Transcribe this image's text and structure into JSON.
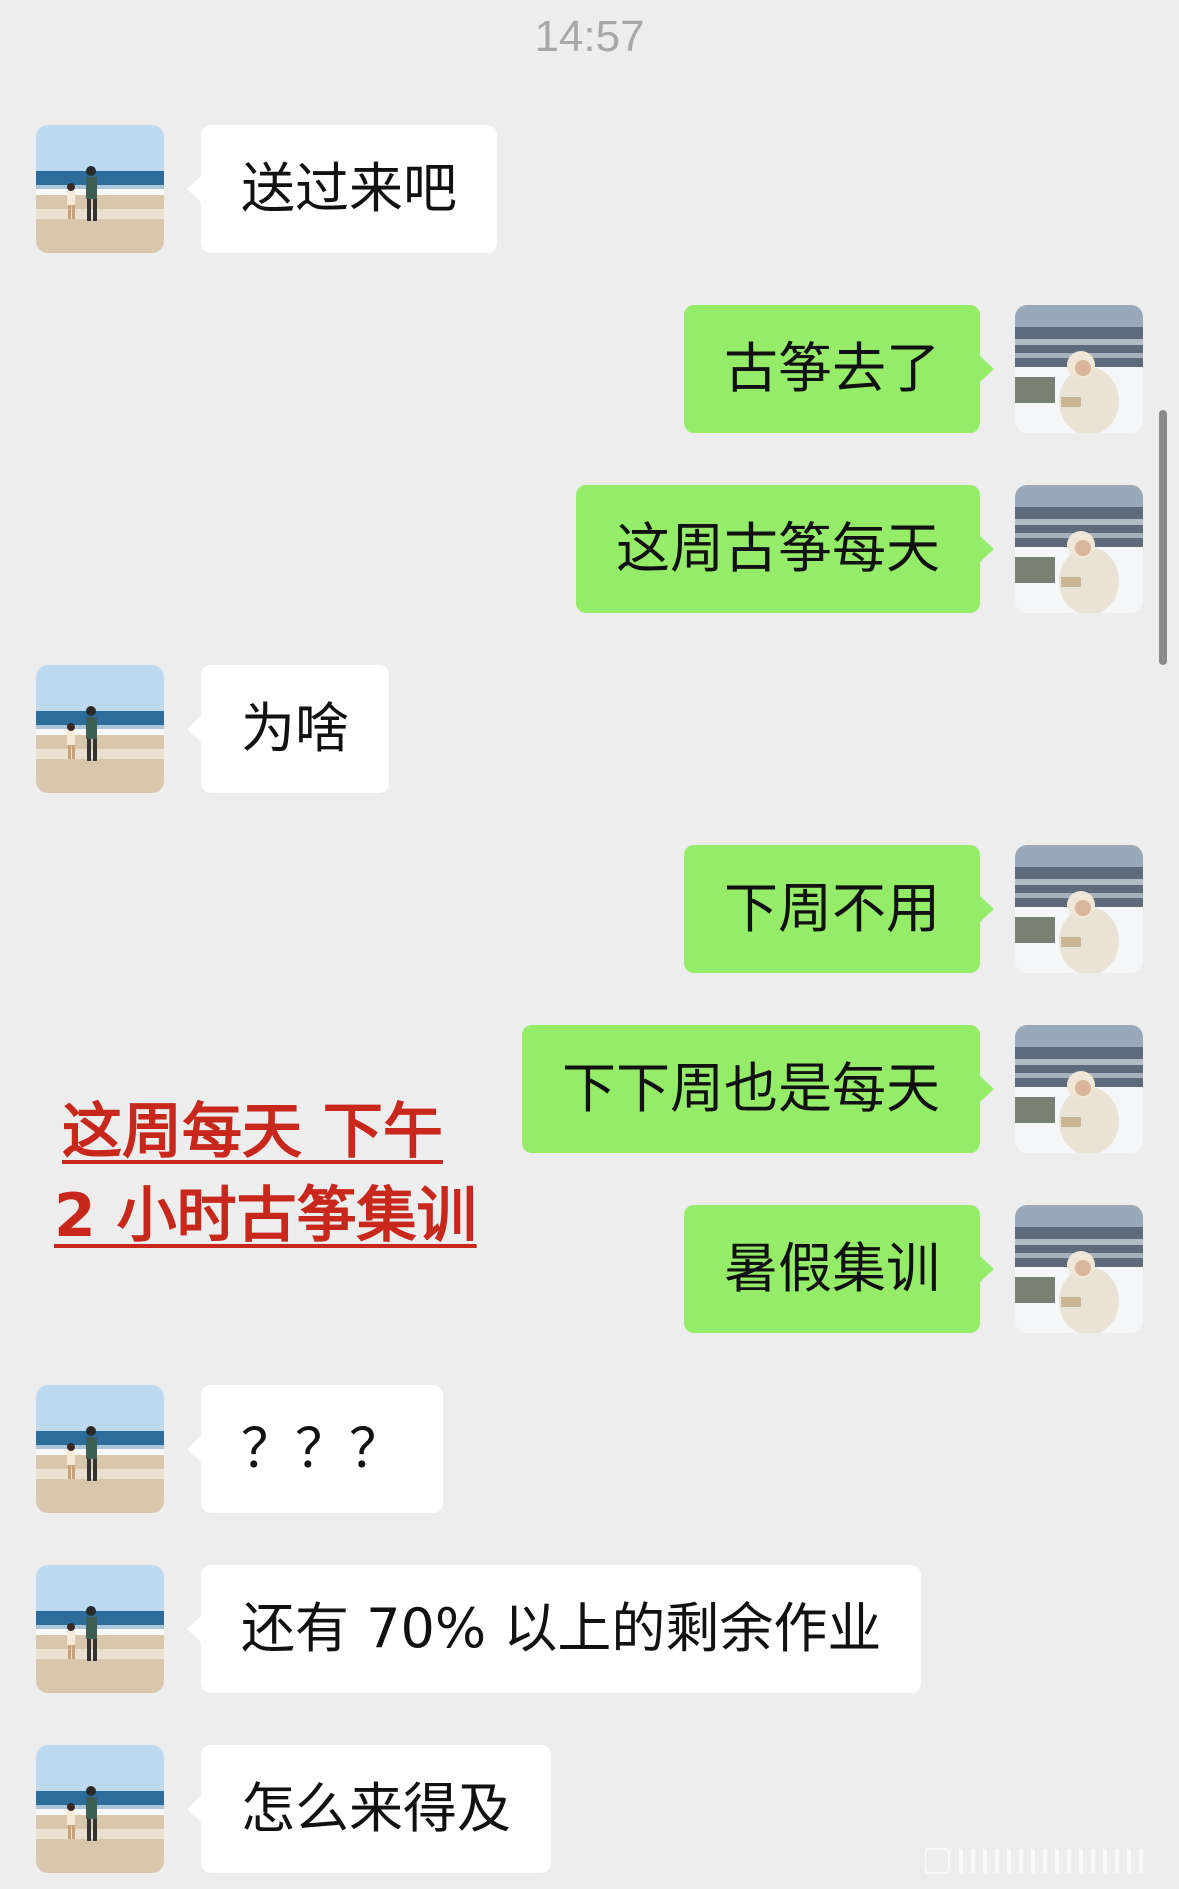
{
  "chat": {
    "timestamp": "14:57",
    "messages": [
      {
        "side": "left",
        "text": "送过来吧",
        "avatar": "beach-avatar-icon"
      },
      {
        "side": "right",
        "text": "古筝去了",
        "avatar": "snow-avatar-icon"
      },
      {
        "side": "right",
        "text": "这周古筝每天",
        "avatar": "snow-avatar-icon"
      },
      {
        "side": "left",
        "text": "为啥",
        "avatar": "beach-avatar-icon"
      },
      {
        "side": "right",
        "text": "下周不用",
        "avatar": "snow-avatar-icon"
      },
      {
        "side": "right",
        "text": "下下周也是每天",
        "avatar": "snow-avatar-icon"
      },
      {
        "side": "right",
        "text": "暑假集训",
        "avatar": "snow-avatar-icon"
      },
      {
        "side": "left",
        "text": "？？？",
        "avatar": "beach-avatar-icon"
      },
      {
        "side": "left",
        "text": "还有 70% 以上的剩余作业",
        "avatar": "beach-avatar-icon"
      },
      {
        "side": "left",
        "text": "怎么来得及",
        "avatar": "beach-avatar-icon"
      }
    ]
  },
  "annotation": {
    "line1": "这周每天 下午",
    "line2": "2 小时古筝集训",
    "color": "#c8281c"
  },
  "colors": {
    "background": "#ededed",
    "sent_bubble": "#95ec69",
    "received_bubble": "#ffffff"
  }
}
